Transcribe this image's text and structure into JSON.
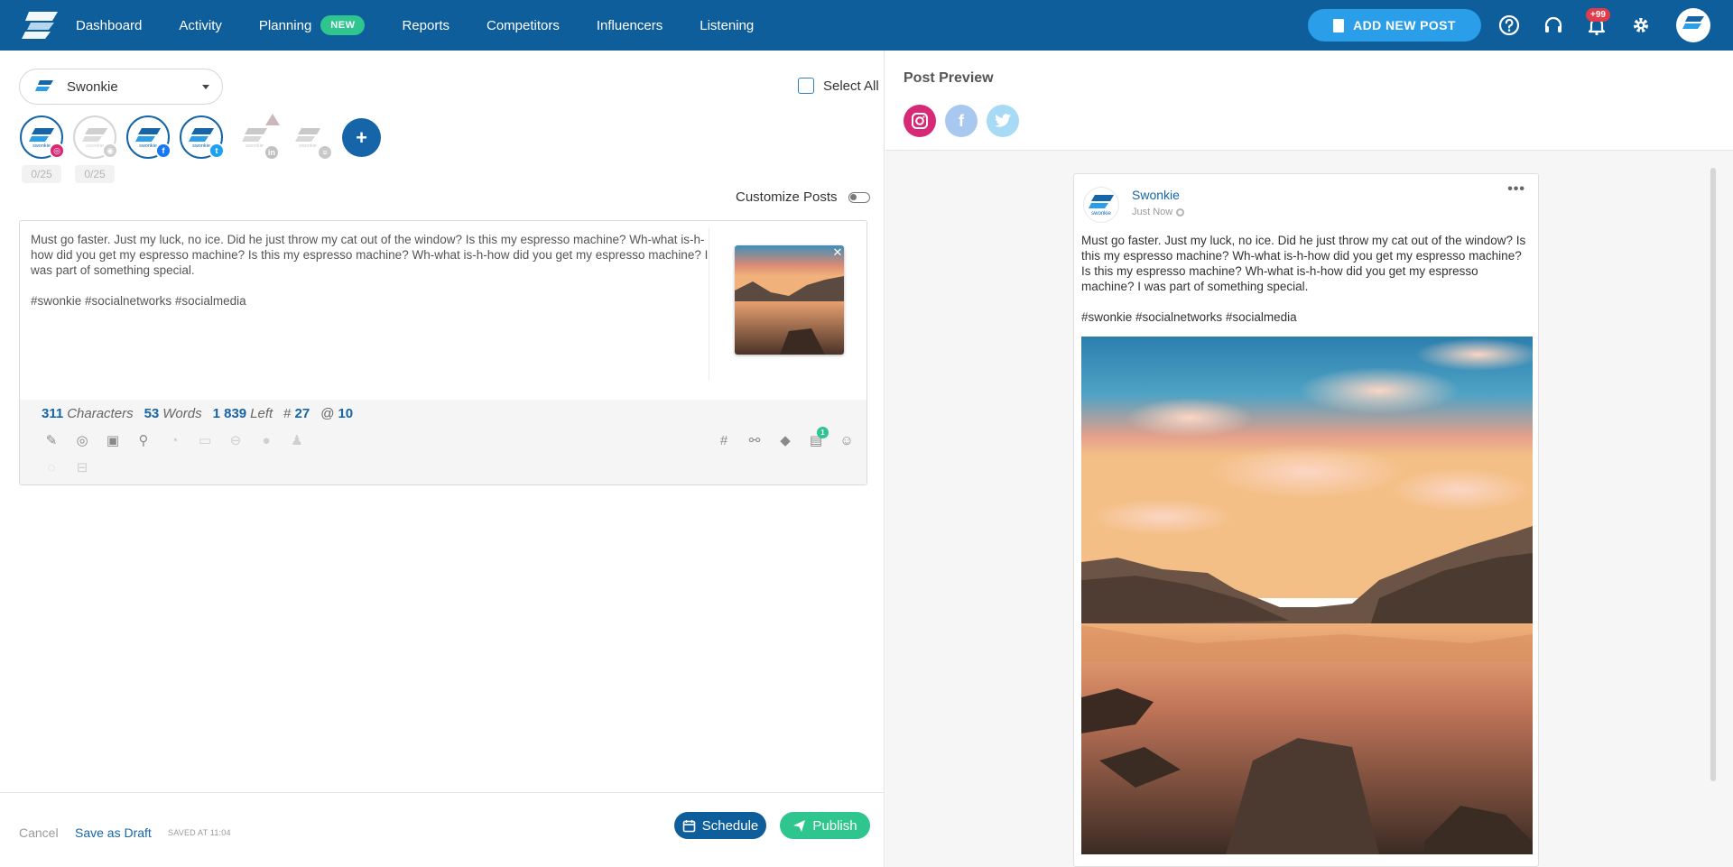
{
  "nav": {
    "links": [
      "Dashboard",
      "Activity",
      "Planning",
      "Reports",
      "Competitors",
      "Influencers",
      "Listening"
    ],
    "planning_badge": "NEW",
    "add_post_label": "ADD NEW POST",
    "notification_count": "+99",
    "avatar_text": "swonkie",
    "brand_color": "#0f5e9c"
  },
  "composer": {
    "account_name": "Swonkie",
    "select_all_label": "Select All",
    "profiles": [
      {
        "network": "instagram",
        "state": "active",
        "count": "0/25"
      },
      {
        "network": "google-my-business",
        "state": "inactive",
        "count": "0/25"
      },
      {
        "network": "facebook",
        "state": "active"
      },
      {
        "network": "twitter",
        "state": "active"
      },
      {
        "network": "linkedin",
        "state": "faded",
        "warning": true
      },
      {
        "network": "other",
        "state": "faded"
      }
    ],
    "add_profile_label": "+",
    "customize_label": "Customize Posts",
    "customize_enabled": false,
    "post_text": "Must go faster. Just my luck, no ice. Did he just throw my cat out of the window? Is this my espresso machine? Wh-what is-h-how did you get my espresso machine? Is this my espresso machine? Wh-what is-h-how did you get my espresso machine? I was part of something special.\n\n#swonkie #socialnetworks #socialmedia",
    "stats": {
      "characters": "311",
      "characters_label": "Characters",
      "words": "53",
      "words_label": "Words",
      "left": "1 839",
      "left_label": "Left",
      "hashtag_symbol": "#",
      "hashtags": "27",
      "mention_symbol": "@",
      "mentions": "10"
    },
    "media_badge": "1"
  },
  "footer": {
    "cancel_label": "Cancel",
    "draft_label": "Save as Draft",
    "saved_label": "SAVED AT 11:04",
    "schedule_label": "Schedule",
    "publish_label": "Publish"
  },
  "preview": {
    "title": "Post Preview",
    "networks": [
      {
        "name": "instagram",
        "color": "#d62976"
      },
      {
        "name": "facebook",
        "color": "#a9c8f0"
      },
      {
        "name": "twitter",
        "color": "#a7daf5"
      }
    ],
    "post": {
      "author": "Swonkie",
      "time": "Just Now",
      "more": "•••",
      "text": "Must go faster. Just my luck, no ice. Did he just throw my cat out of the window? Is this my espresso machine? Wh-what is-h-how did you get my espresso machine? Is this my espresso machine? Wh-what is-h-how did you get my espresso machine? I was part of something special.\n\n#swonkie #socialnetworks #socialmedia"
    }
  }
}
